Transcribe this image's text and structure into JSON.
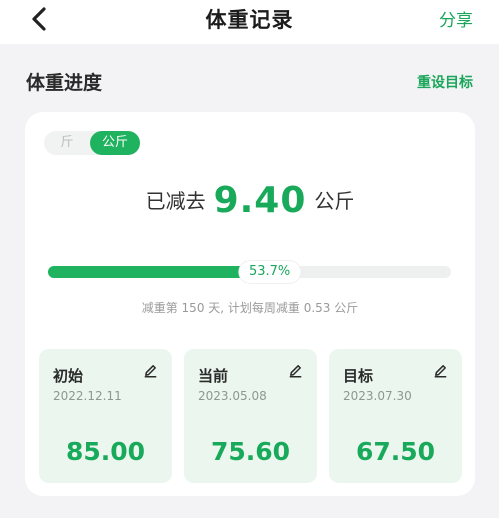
{
  "nav": {
    "title": "体重记录",
    "share_label": "分享"
  },
  "section": {
    "title": "体重进度",
    "reset_label": "重设目标"
  },
  "unit_toggle": {
    "jin": "斤",
    "kg": "公斤",
    "selected": "kg"
  },
  "summary": {
    "prefix": "已减去",
    "value": "9.40",
    "unit": "公斤"
  },
  "progress": {
    "fraction": 0.537,
    "label": "53.7%"
  },
  "note": "减重第 150 天, 计划每周减重 0.53 公斤",
  "stats": [
    {
      "label": "初始",
      "date": "2022.12.11",
      "value": "85.00"
    },
    {
      "label": "当前",
      "date": "2023.05.08",
      "value": "75.60"
    },
    {
      "label": "目标",
      "date": "2023.07.30",
      "value": "67.50"
    }
  ],
  "icons": {
    "back": "chevron-left-icon",
    "edit": "pencil-icon"
  },
  "colors": {
    "accent": "#1fb25f",
    "text_accent": "#19a95a",
    "stat_bg": "#eaf6ee"
  }
}
